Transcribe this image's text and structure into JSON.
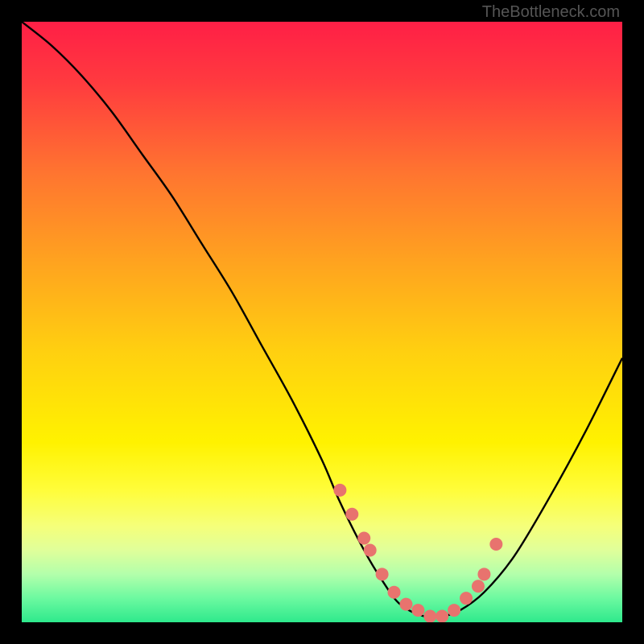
{
  "watermark": "TheBottleneck.com",
  "chart_data": {
    "type": "line",
    "title": "",
    "xlabel": "",
    "ylabel": "",
    "xlim": [
      0,
      100
    ],
    "ylim": [
      0,
      100
    ],
    "grid": false,
    "legend": false,
    "series": [
      {
        "name": "bottleneck-curve",
        "x": [
          0,
          5,
          10,
          15,
          20,
          25,
          30,
          35,
          40,
          45,
          50,
          53,
          57,
          60,
          63,
          67,
          70,
          73,
          77,
          82,
          88,
          94,
          100
        ],
        "y": [
          100,
          96,
          91,
          85,
          78,
          71,
          63,
          55,
          46,
          37,
          27,
          20,
          12,
          7,
          3,
          1,
          1,
          2,
          5,
          11,
          21,
          32,
          44
        ]
      }
    ],
    "points": {
      "name": "sweet-spot-markers",
      "x": [
        53,
        55,
        57,
        58,
        60,
        62,
        64,
        66,
        68,
        70,
        72,
        74,
        76,
        77,
        79
      ],
      "y": [
        22,
        18,
        14,
        12,
        8,
        5,
        3,
        2,
        1,
        1,
        2,
        4,
        6,
        8,
        13
      ]
    },
    "gradient_stops": [
      {
        "offset": 0.0,
        "color": "#ff1f46"
      },
      {
        "offset": 0.1,
        "color": "#ff3a3f"
      },
      {
        "offset": 0.25,
        "color": "#ff7430"
      },
      {
        "offset": 0.4,
        "color": "#ffa31f"
      },
      {
        "offset": 0.55,
        "color": "#ffd010"
      },
      {
        "offset": 0.7,
        "color": "#fff200"
      },
      {
        "offset": 0.78,
        "color": "#fffd3a"
      },
      {
        "offset": 0.84,
        "color": "#f5ff7a"
      },
      {
        "offset": 0.88,
        "color": "#e0ff9a"
      },
      {
        "offset": 0.92,
        "color": "#b3ffab"
      },
      {
        "offset": 0.96,
        "color": "#6cf9a0"
      },
      {
        "offset": 1.0,
        "color": "#2ee98c"
      }
    ],
    "marker_color": "#e8736e",
    "curve_color": "#000000"
  }
}
